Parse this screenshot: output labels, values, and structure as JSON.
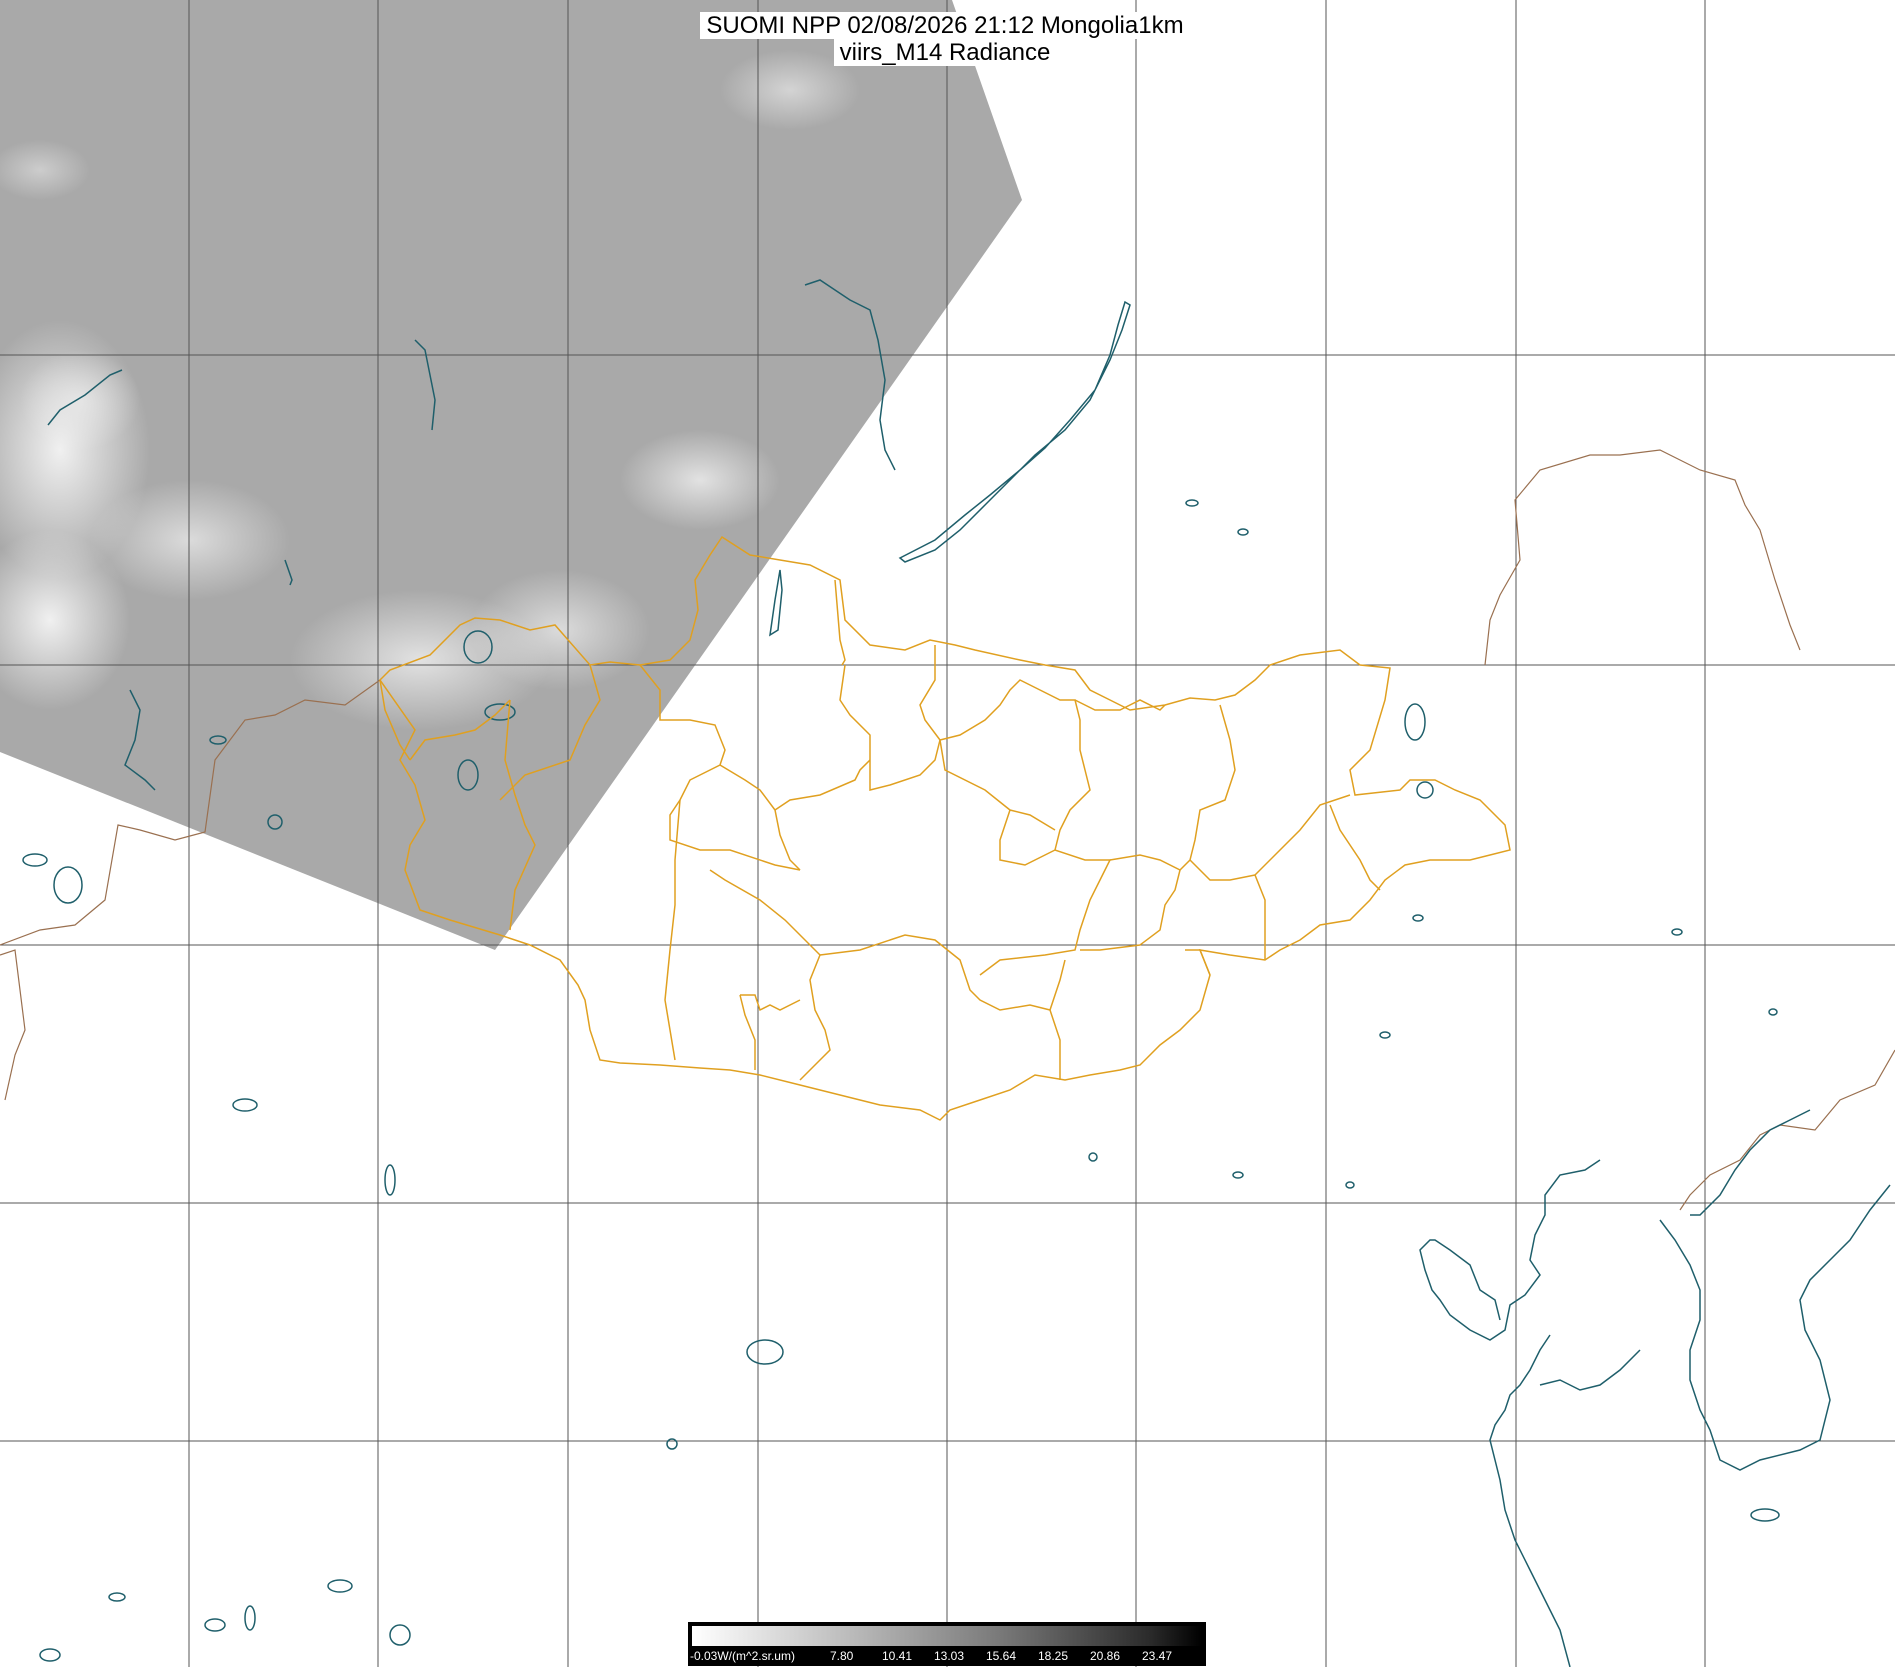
{
  "header": {
    "line1": "SUOMI NPP 02/08/2026 21:12 Mongolia1km",
    "line2": "viirs_M14 Radiance"
  },
  "colorbar": {
    "unit_label": "-0.03W/(m^2.sr.um)",
    "ticks": [
      "7.80",
      "10.41",
      "13.03",
      "15.64",
      "18.25",
      "20.86",
      "23.47"
    ]
  },
  "colors": {
    "swath": "#a9a9a9",
    "grid": "#555555",
    "coast": "#1f5f6b",
    "province_border": "#e0a020",
    "country_border": "#9a7050"
  },
  "map_layers": [
    "satellite-swath",
    "graticule",
    "coastlines-lakes",
    "country-borders",
    "province-borders"
  ]
}
